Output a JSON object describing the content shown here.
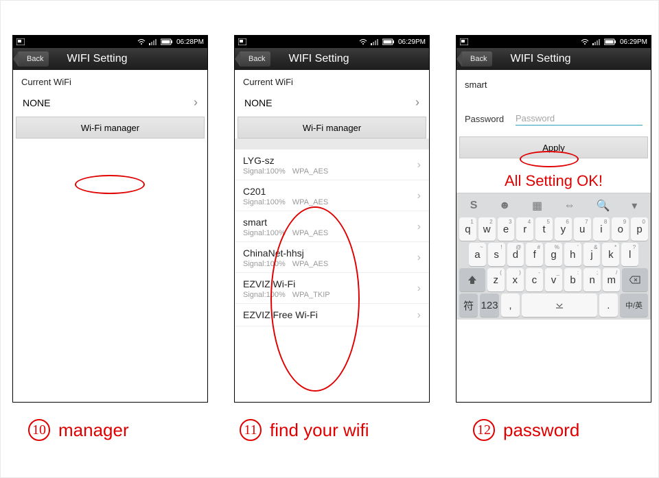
{
  "statusbar": {
    "time10": "06:28PM",
    "time11": "06:29PM",
    "time12": "06:29PM"
  },
  "header": {
    "back": "Back",
    "title": "WIFI Setting"
  },
  "panel10": {
    "currentLabel": "Current WiFi",
    "currentValue": "NONE",
    "managerBtn": "Wi-Fi manager"
  },
  "panel11": {
    "currentLabel": "Current WiFi",
    "currentValue": "NONE",
    "managerBtn": "Wi-Fi manager",
    "networks": [
      {
        "name": "LYG-sz",
        "signal": "Signal:100%",
        "sec": "WPA_AES"
      },
      {
        "name": "C201",
        "signal": "Signal:100%",
        "sec": "WPA_AES"
      },
      {
        "name": "smart",
        "signal": "Signal:100%",
        "sec": "WPA_AES"
      },
      {
        "name": "ChinaNet-hhsj",
        "signal": "Signal:100%",
        "sec": "WPA_AES"
      },
      {
        "name": "EZVIZ Wi-Fi",
        "signal": "Signal:100%",
        "sec": "WPA_TKIP"
      },
      {
        "name": "EZVIZ Free Wi-Fi",
        "signal": "",
        "sec": ""
      }
    ]
  },
  "panel12": {
    "ssid": "smart",
    "pwLabel": "Password",
    "pwPlaceholder": "Password",
    "applyBtn": "Apply",
    "okText": "All Setting OK!"
  },
  "keyboard": {
    "row1": [
      {
        "k": "q",
        "s": "1"
      },
      {
        "k": "w",
        "s": "2"
      },
      {
        "k": "e",
        "s": "3"
      },
      {
        "k": "r",
        "s": "4"
      },
      {
        "k": "t",
        "s": "5"
      },
      {
        "k": "y",
        "s": "6"
      },
      {
        "k": "u",
        "s": "7"
      },
      {
        "k": "i",
        "s": "8"
      },
      {
        "k": "o",
        "s": "9"
      },
      {
        "k": "p",
        "s": "0"
      }
    ],
    "row2": [
      {
        "k": "a",
        "s": "~"
      },
      {
        "k": "s",
        "s": "!"
      },
      {
        "k": "d",
        "s": "@"
      },
      {
        "k": "f",
        "s": "#"
      },
      {
        "k": "g",
        "s": "%"
      },
      {
        "k": "h",
        "s": "'"
      },
      {
        "k": "j",
        "s": "&"
      },
      {
        "k": "k",
        "s": "*"
      },
      {
        "k": "l",
        "s": "?"
      }
    ],
    "row3": [
      {
        "k": "z",
        "s": "("
      },
      {
        "k": "x",
        "s": ")"
      },
      {
        "k": "c",
        "s": "-"
      },
      {
        "k": "v",
        "s": "_"
      },
      {
        "k": "b",
        "s": ":"
      },
      {
        "k": "n",
        "s": ";"
      },
      {
        "k": "m",
        "s": "/"
      }
    ],
    "row4": {
      "sym": "符",
      "num": "123",
      "comma": ",",
      "period": ".",
      "lang": "中/英"
    }
  },
  "captions": {
    "n10": "10",
    "t10": "manager",
    "n11": "11",
    "t11": "find  your wifi",
    "n12": "12",
    "t12": "password"
  }
}
